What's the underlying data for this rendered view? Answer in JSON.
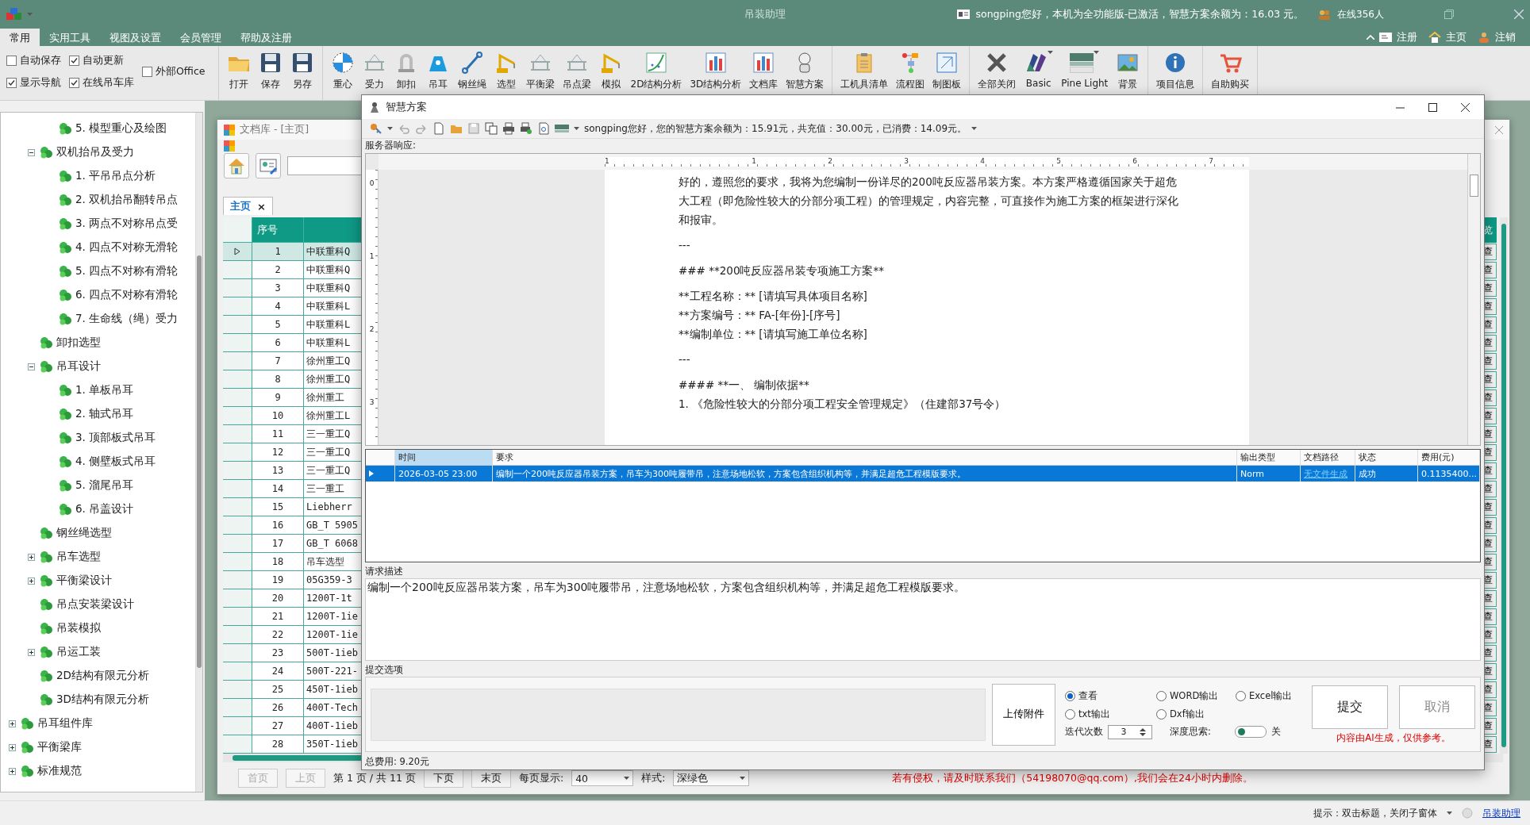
{
  "title_bar": {
    "title": "吊装助理",
    "greeting": "songping您好，本机为全功能版-已激活，智慧方案余额为：16.03 元。",
    "online": "在线356人"
  },
  "menu": {
    "tabs": [
      {
        "label": "常用",
        "selected": true
      },
      {
        "label": "实用工具",
        "selected": false
      },
      {
        "label": "视图及设置",
        "selected": false
      },
      {
        "label": "会员管理",
        "selected": false
      },
      {
        "label": "帮助及注册",
        "selected": false
      }
    ],
    "links": [
      "注册",
      "主页",
      "注销"
    ]
  },
  "ribbon": {
    "checkboxes": [
      {
        "label": "自动保存",
        "checked": false
      },
      {
        "label": "自动更新",
        "checked": true
      },
      {
        "label": "外部Office",
        "checked": false
      },
      {
        "label": "显示导航",
        "checked": true
      },
      {
        "label": "在线吊车库",
        "checked": true
      }
    ],
    "groups": [
      {
        "buttons": [
          {
            "label": "打开"
          },
          {
            "label": "保存"
          },
          {
            "label": "另存"
          }
        ]
      },
      {
        "buttons": [
          {
            "label": "重心"
          },
          {
            "label": "受力"
          },
          {
            "label": "卸扣"
          },
          {
            "label": "吊耳"
          },
          {
            "label": "钢丝绳"
          },
          {
            "label": "选型"
          },
          {
            "label": "平衡梁"
          },
          {
            "label": "吊点梁"
          },
          {
            "label": "模拟"
          },
          {
            "label": "2D结构分析"
          },
          {
            "label": "3D结构分析"
          },
          {
            "label": "文档库"
          },
          {
            "label": "智慧方案"
          }
        ]
      },
      {
        "buttons": [
          {
            "label": "工机具清单"
          },
          {
            "label": "流程图"
          },
          {
            "label": "制图板"
          }
        ]
      },
      {
        "buttons": [
          {
            "label": "全部关闭"
          },
          {
            "label": "Basic",
            "dropdown": true
          },
          {
            "label": "Pine Light",
            "dropdown": true
          },
          {
            "label": "背景"
          }
        ]
      },
      {
        "buttons": [
          {
            "label": "项目信息"
          }
        ]
      },
      {
        "buttons": [
          {
            "label": "自助购买"
          }
        ]
      }
    ]
  },
  "tree": [
    {
      "children": [
        {
          "children": [
            {
              "label": "5. 模型重心及绘图"
            }
          ]
        },
        {
          "label": "双机抬吊及受力",
          "expanded": true,
          "children": [
            {
              "label": "1. 平吊吊点分析"
            },
            {
              "label": "2. 双机抬吊翻转吊点"
            },
            {
              "label": "3. 两点不对称吊点受"
            },
            {
              "label": "4. 四点不对称无滑轮"
            },
            {
              "label": "5. 四点不对称有滑轮"
            },
            {
              "label": "6. 四点不对称有滑轮"
            },
            {
              "label": "7. 生命线（绳）受力"
            }
          ]
        },
        {
          "label": "卸扣选型"
        },
        {
          "label": "吊耳设计",
          "expanded": true,
          "children": [
            {
              "label": "1. 单板吊耳"
            },
            {
              "label": "2. 轴式吊耳"
            },
            {
              "label": "3. 顶部板式吊耳"
            },
            {
              "label": "4. 侧壁板式吊耳"
            },
            {
              "label": "5. 溜尾吊耳"
            },
            {
              "label": "6. 吊盖设计"
            }
          ]
        },
        {
          "label": "钢丝绳选型"
        },
        {
          "label": "吊车选型",
          "expanded": false
        },
        {
          "label": "平衡梁设计",
          "expanded": false
        },
        {
          "label": "吊点安装梁设计"
        },
        {
          "label": "吊装模拟"
        },
        {
          "label": "吊运工装",
          "expanded": false
        },
        {
          "label": "2D结构有限元分析"
        },
        {
          "label": "3D结构有限元分析"
        }
      ]
    },
    {
      "label": "吊耳组件库",
      "expanded": false
    },
    {
      "label": "平衡梁库",
      "expanded": false
    },
    {
      "label": "标准规范",
      "expanded": false
    }
  ],
  "doc_library": {
    "title": "文档库 - [主页]",
    "tab": {
      "label": "主页",
      "close": "×"
    },
    "columns": [
      "序号"
    ],
    "side_column": "览",
    "rows": [
      {
        "no": "1",
        "name": "中联重科Q",
        "action": "查",
        "selected": true
      },
      {
        "no": "2",
        "name": "中联重科Q",
        "action": "查",
        "selected": false
      },
      {
        "no": "3",
        "name": "中联重科Q",
        "action": "查",
        "selected": false
      },
      {
        "no": "4",
        "name": "中联重科L",
        "action": "查",
        "selected": false
      },
      {
        "no": "5",
        "name": "中联重科L",
        "action": "查",
        "selected": false
      },
      {
        "no": "6",
        "name": "中联重科L",
        "action": "查",
        "selected": false
      },
      {
        "no": "7",
        "name": "徐州重工Q",
        "action": "查",
        "selected": false
      },
      {
        "no": "8",
        "name": "徐州重工Q",
        "action": "查",
        "selected": false
      },
      {
        "no": "9",
        "name": "徐州重工",
        "action": "查",
        "selected": false
      },
      {
        "no": "10",
        "name": "徐州重工L",
        "action": "查",
        "selected": false
      },
      {
        "no": "11",
        "name": "三一重工Q",
        "action": "查",
        "selected": false
      },
      {
        "no": "12",
        "name": "三一重工Q",
        "action": "查",
        "selected": false
      },
      {
        "no": "13",
        "name": "三一重工Q",
        "action": "查",
        "selected": false
      },
      {
        "no": "14",
        "name": "三一重工",
        "action": "查",
        "selected": false
      },
      {
        "no": "15",
        "name": "Liebherr",
        "action": "查",
        "selected": false
      },
      {
        "no": "16",
        "name": "GB_T 5905",
        "action": "查",
        "selected": false
      },
      {
        "no": "17",
        "name": "GB_T 6068",
        "action": "查",
        "selected": false
      },
      {
        "no": "18",
        "name": "吊车选型",
        "action": "查",
        "selected": false
      },
      {
        "no": "19",
        "name": "05G359-3",
        "action": "查",
        "selected": false
      },
      {
        "no": "20",
        "name": "1200T-1t",
        "action": "查",
        "selected": false
      },
      {
        "no": "21",
        "name": "1200T-1ie",
        "action": "查",
        "selected": false
      },
      {
        "no": "22",
        "name": "1200T-1ie",
        "action": "查",
        "selected": false
      },
      {
        "no": "23",
        "name": "500T-1ieb",
        "action": "查",
        "selected": false
      },
      {
        "no": "24",
        "name": "500T-221-",
        "action": "查",
        "selected": false
      },
      {
        "no": "25",
        "name": "450T-1ieb",
        "action": "查",
        "selected": false
      },
      {
        "no": "26",
        "name": "400T-Tech",
        "action": "查",
        "selected": false
      },
      {
        "no": "27",
        "name": "400T-1ieb",
        "action": "查",
        "selected": false
      },
      {
        "no": "28",
        "name": "350T-1ieb",
        "action": "查",
        "selected": false
      }
    ],
    "pager": {
      "buttons_before": [
        {
          "label": "首页",
          "disabled": true
        },
        {
          "label": "上页",
          "disabled": true
        }
      ],
      "info": "第 1 页 / 共 11 页",
      "buttons_after": [
        {
          "label": "下页",
          "disabled": false
        },
        {
          "label": "末页",
          "disabled": false
        }
      ],
      "page_size_label": "每页显示:",
      "page_size": "40",
      "style_label": "样式:",
      "style": "深绿色",
      "notice": "若有侵权，请及时联系我们（54198070@qq.com）,我们会在24小时内删除。"
    }
  },
  "dialog": {
    "title": "智慧方案",
    "balance": "songping您好，您的智慧方案余额为：15.91元，共充值：30.00元，已消费：14.09元。",
    "response_label": "服务器响应:",
    "ruler": {
      "horizontal": [
        "1",
        "1",
        "2",
        "3",
        "4",
        "5",
        "6",
        "7"
      ],
      "vertical": [
        "0",
        "1",
        "2",
        "3"
      ]
    },
    "document": [
      [
        "好的，遵照您的要求，我将为您编制一份详尽的200吨反应器吊装方案。本方案严格遵循国家关于超危大工程（即危险性较大的分部分项工程）的管理规定，内容完整，可直接作为施工方案的框架进行深化和报审。"
      ],
      [
        "---"
      ],
      [
        "### **200吨反应器吊装专项施工方案**"
      ],
      [
        "**工程名称：** [请填写具体项目名称]",
        "**方案编号：** FA-[年份]-[序号]",
        "**编制单位：** [请填写施工单位名称]"
      ],
      [
        "---"
      ],
      [
        "#### **一、 编制依据**",
        "1. 《危险性较大的分部分项工程安全管理规定》（住建部37号令）"
      ]
    ],
    "history": {
      "columns": [
        {
          "label": "时间",
          "selected": true
        },
        {
          "label": "要求",
          "selected": false
        },
        {
          "label": "输出类型",
          "selected": false
        },
        {
          "label": "文档路径",
          "selected": false
        },
        {
          "label": "状态",
          "selected": false
        },
        {
          "label": "费用(元)",
          "selected": false
        }
      ],
      "rows": [
        {
          "selected": true,
          "time": "2026-03-05 23:00",
          "request": "编制一个200吨反应器吊装方案，吊车为300吨履带吊，注意场地松软，方案包含组织机构等，并满足超危工程模版要求。",
          "output_type": "Norm",
          "path": "无文件生成",
          "status": "成功",
          "cost": "0.1135400..."
        }
      ]
    },
    "request_label": "请求描述",
    "request": "编制一个200吨反应器吊装方案，吊车为300吨履带吊，注意场地松软，方案包含组织机构等，并满足超危工程模版要求。",
    "options_label": "提交选项",
    "upload": "上传附件",
    "outputs": [
      {
        "label": "查看",
        "selected": true
      },
      {
        "label": "WORD输出",
        "selected": false
      },
      {
        "label": "Excel输出",
        "selected": false
      },
      {
        "label": "txt输出",
        "selected": false
      },
      {
        "label": "Dxf输出",
        "selected": false
      }
    ],
    "iterations_label": "迭代次数",
    "iterations": "3",
    "deep_label": "深度思索:",
    "deep": {
      "on": false,
      "label": "关"
    },
    "submit": "提交",
    "cancel": "取消",
    "disclaimer": "内容由AI生成，仅供参考。",
    "total": "总费用: 9.20元"
  },
  "status_bar": {
    "hint": "提示：双击标题，关闭子窗体",
    "link": "吊装助理"
  }
}
